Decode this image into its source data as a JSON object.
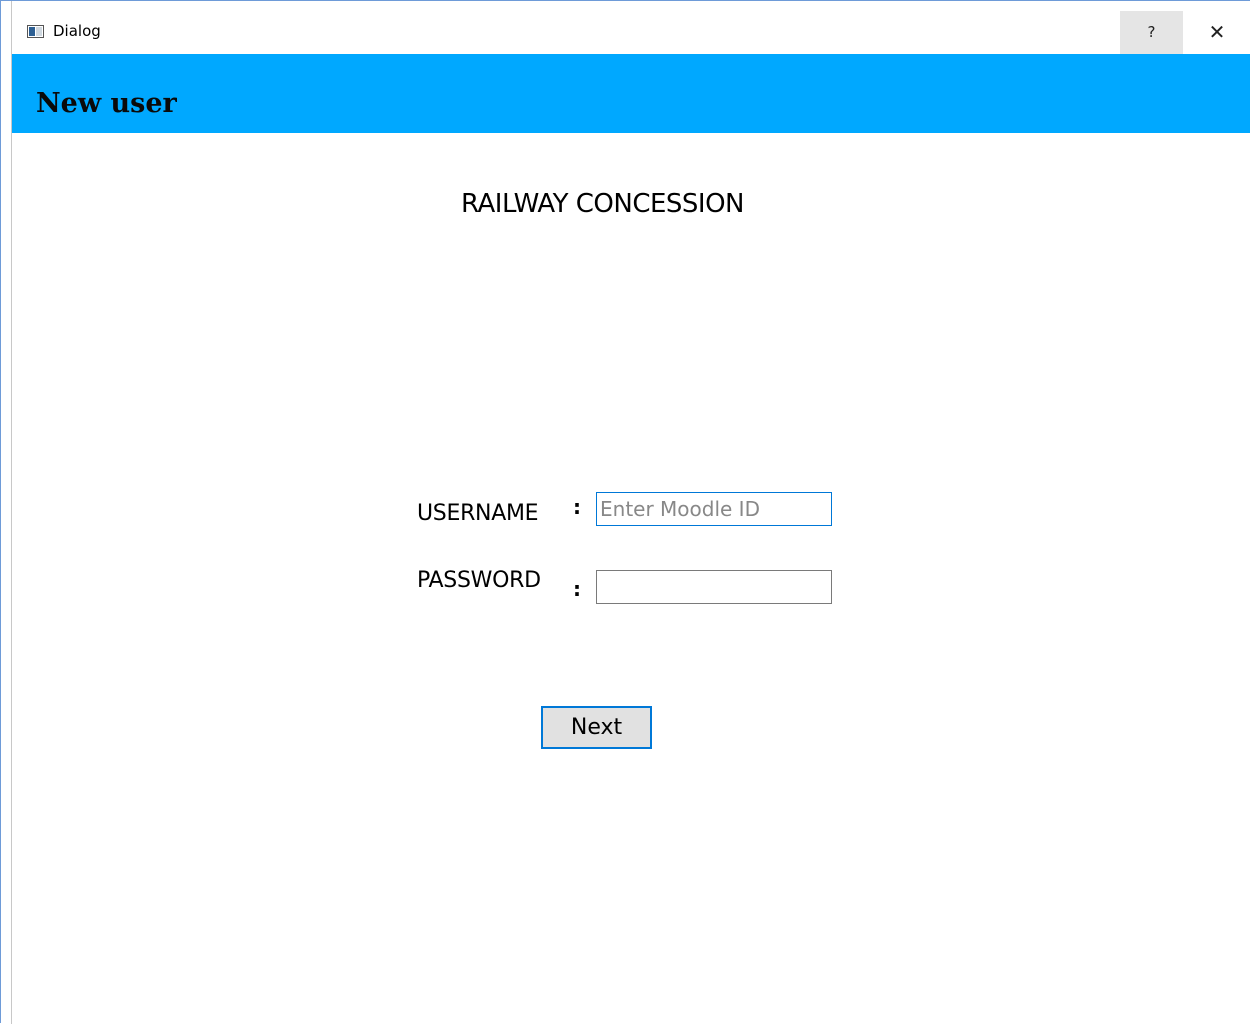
{
  "window": {
    "title": "Dialog",
    "help_label": "?",
    "close_label": "✕"
  },
  "header": {
    "title": "New user",
    "background_color": "#00a8ff"
  },
  "main": {
    "title": "RAILWAY CONCESSION"
  },
  "form": {
    "username_label": "USERNAME",
    "username_colon": ":",
    "username_value": "",
    "username_placeholder": "Enter Moodle ID",
    "password_label": "PASSWORD",
    "password_colon": ":",
    "password_value": "",
    "password_placeholder": ""
  },
  "actions": {
    "next_label": "Next"
  },
  "colors": {
    "accent": "#0078d7",
    "button_bg": "#e1e1e1"
  }
}
